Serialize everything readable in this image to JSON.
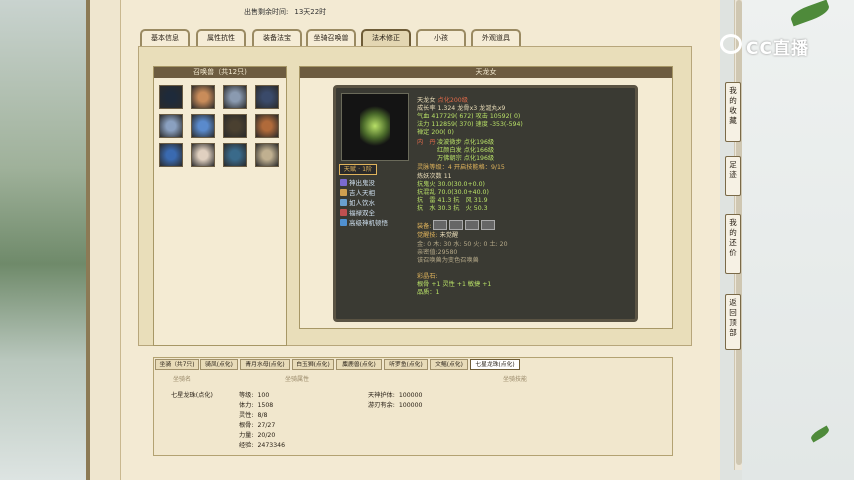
{
  "timer": {
    "label": "出售剩余时间:",
    "value": "13天22时"
  },
  "tabs": [
    "基本信息",
    "属性抗性",
    "装备法宝",
    "坐骑召唤兽",
    "法术修正",
    "小孩",
    "外观道具"
  ],
  "summon_panel": {
    "title": "召唤兽（共12只)",
    "colors": [
      "#1e2a3a",
      "#c98c5a",
      "#8a9ab0",
      "#3a4a6a",
      "#8aa0c0",
      "#5a8acc",
      "#4a4030",
      "#b06a3a",
      "#3a6ab0",
      "#e0d0c0",
      "#3a6a8a",
      "#c0b090"
    ]
  },
  "detail": {
    "panel_title": "天龙女",
    "name": "天龙女",
    "name_suffix": "点化200级",
    "growth": "成长率 1.324 龙骨x3 龙涎丸x9",
    "hp": "气血 417729( 672) 攻击 10592( 0)",
    "mp": "法力 112859( 370) 速度 -353(-594)",
    "zen": "禅定 200( 0)",
    "dan_label": "内　丹",
    "dan1": "凌波微步 点化196级",
    "dan2": "红颜白发 点化166级",
    "dan3": "万佛朝宗 点化196级",
    "spirit": "灵脉等级：4 开启技能格：9/15",
    "practice": "炼妖次数 11",
    "res1": "抗鬼火 30.0(30.0+0.0)",
    "res2": "抗混乱 70.0(30.0+40.0)",
    "res3": "抗　雷 41.3 抗　风 31.9",
    "res4": "抗　水 30.3 抗　火 50.3",
    "equip_label": "装备:",
    "awaken_label": "觉醒技:",
    "awaken_value": "未觉醒",
    "elements": "金: 0 木: 30 水: 50 火: 0 土: 20",
    "intimacy": "亲密值:29580",
    "guard": "该召唤兽为变色召唤兽",
    "colorstone_label": "彩晶石:",
    "colorstone1": "根骨 +1 灵性 +1 敏捷 +1",
    "colorstone2": "品质：1",
    "level_badge": "天赋 · 1阶",
    "skills": [
      {
        "name": "神出鬼没",
        "color": "#7a6ad0"
      },
      {
        "name": "吉人天相",
        "color": "#d0a050"
      },
      {
        "name": "如人饮水",
        "color": "#6aa0d0"
      },
      {
        "name": "福禄双全",
        "color": "#c05050"
      },
      {
        "name": "高级神机顿悟",
        "color": "#5090d0"
      }
    ]
  },
  "bottom": {
    "tabs": [
      "坐骑（共7只)",
      "骑凤(点化)",
      "青月水母(点化)",
      "白玉狮(点化)",
      "麋鹿兽(点化)",
      "听罗鱼(点化)",
      "文鳐(点化)",
      "七星龙珠(点化)"
    ],
    "col_heads": [
      "坐骑名",
      "坐骑属性",
      "坐骑技能"
    ],
    "mount_name": "七星龙珠(点化)",
    "attrs": [
      {
        "k": "等级:",
        "v": "100"
      },
      {
        "k": "体力:",
        "v": "1508"
      },
      {
        "k": "灵性:",
        "v": "8/8"
      },
      {
        "k": "根骨:",
        "v": "27/27"
      },
      {
        "k": "力量:",
        "v": "20/20"
      },
      {
        "k": "经验:",
        "v": "2473346"
      }
    ],
    "skills": [
      {
        "k": "天神护体:",
        "v": "100000"
      },
      {
        "k": "游刃有余:",
        "v": "100000"
      }
    ]
  },
  "right_nav": [
    "我的收藏",
    "足迹",
    "我的还价",
    "返回顶部"
  ],
  "cc_logo": "CC直播"
}
